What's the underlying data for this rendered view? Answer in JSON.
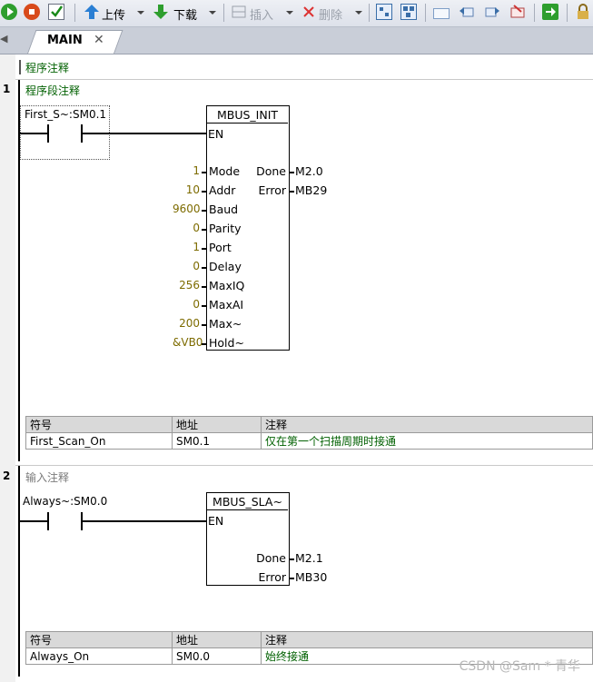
{
  "toolbar": {
    "upload_label": "上传",
    "download_label": "下载",
    "insert_label": "插入",
    "delete_label": "删除"
  },
  "tabs": [
    {
      "label": "MAIN"
    }
  ],
  "program_comment": "程序注释",
  "networks": [
    {
      "number": "1",
      "comment": "程序段注释",
      "contact_label": "First_S~:SM0.1",
      "block": {
        "title": "MBUS_INIT",
        "en": "EN",
        "inputs": [
          {
            "value": "1",
            "pin": "Mode"
          },
          {
            "value": "10",
            "pin": "Addr"
          },
          {
            "value": "9600",
            "pin": "Baud"
          },
          {
            "value": "0",
            "pin": "Parity"
          },
          {
            "value": "1",
            "pin": "Port"
          },
          {
            "value": "0",
            "pin": "Delay"
          },
          {
            "value": "256",
            "pin": "MaxIQ"
          },
          {
            "value": "0",
            "pin": "MaxAI"
          },
          {
            "value": "200",
            "pin": "Max~"
          },
          {
            "value": "&VB0",
            "pin": "Hold~"
          }
        ],
        "outputs": [
          {
            "pin": "Done",
            "value": "M2.0"
          },
          {
            "pin": "Error",
            "value": "MB29"
          }
        ]
      },
      "symbol_table": {
        "headers": [
          "符号",
          "地址",
          "注释"
        ],
        "rows": [
          [
            "First_Scan_On",
            "SM0.1",
            "仅在第一个扫描周期时接通"
          ]
        ]
      }
    },
    {
      "number": "2",
      "comment": "输入注释",
      "contact_label": "Always~:SM0.0",
      "block": {
        "title": "MBUS_SLA~",
        "en": "EN",
        "outputs": [
          {
            "pin": "Done",
            "value": "M2.1"
          },
          {
            "pin": "Error",
            "value": "MB30"
          }
        ]
      },
      "symbol_table": {
        "headers": [
          "符号",
          "地址",
          "注释"
        ],
        "rows": [
          [
            "Always_On",
            "SM0.0",
            "始终接通"
          ]
        ]
      }
    }
  ],
  "watermark": "CSDN @Sam * 青华"
}
